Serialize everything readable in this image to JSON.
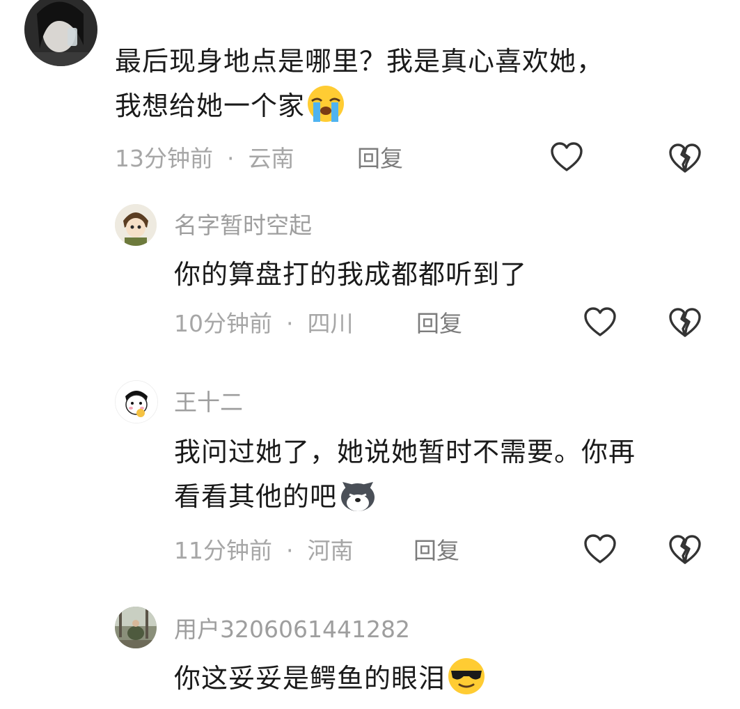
{
  "comments": [
    {
      "content_line1": "最后现身地点是哪里？我是真心喜欢她，",
      "content_line2": "我想给她一个家",
      "content_emoji": "crying-face-emoji",
      "time": "13分钟前",
      "location": "云南",
      "reply_label": "回复",
      "sep": "·"
    },
    {
      "username": "名字暂时空起",
      "content_line1": "你的算盘打的我成都都听到了",
      "time": "10分钟前",
      "location": "四川",
      "reply_label": "回复",
      "sep": "·"
    },
    {
      "username": "王十二",
      "content_line1": "我问过她了，她说她暂时不需要。你再",
      "content_line2": "看看其他的吧",
      "content_emoji": "husky-dog-emoji",
      "time": "11分钟前",
      "location": "河南",
      "reply_label": "回复",
      "sep": "·"
    },
    {
      "username": "用户3206061441282",
      "content_line1": "你这妥妥是鳄鱼的眼泪",
      "content_emoji": "sunglasses-face-emoji"
    }
  ],
  "icons": {
    "like": "heart-outline-icon",
    "dislike": "broken-heart-icon"
  }
}
